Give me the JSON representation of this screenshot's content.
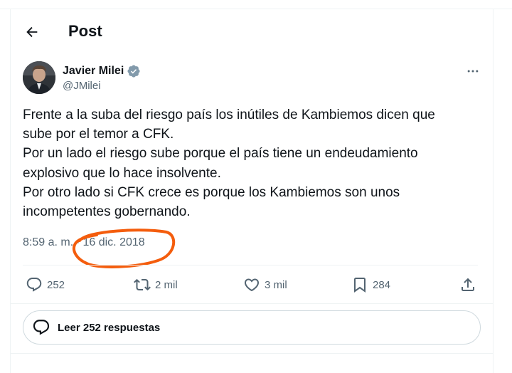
{
  "header": {
    "title": "Post",
    "back_icon": "arrow-left-icon"
  },
  "author": {
    "name": "Javier Milei",
    "handle": "@JMilei",
    "verified_icon": "verified-badge-icon",
    "verified_color": "#829aab"
  },
  "tweet": {
    "lines": [
      "Frente a la suba del riesgo país los inútiles de Kambiemos dicen que",
      "sube por el temor a CFK.",
      "Por un lado el riesgo sube porque el país tiene un endeudamiento",
      "explosivo que lo hace insolvente.",
      "Por otro lado si CFK crece es porque los Kambiemos son unos",
      "incompetentes gobernando."
    ]
  },
  "meta": {
    "time": "8:59 a. m.",
    "separator": "·",
    "date": "16 dic. 2018",
    "annotation_color": "#f45d0d"
  },
  "actions": {
    "replies": "252",
    "retweets": "2 mil",
    "likes": "3 mil",
    "bookmarks": "284"
  },
  "read_replies_label": "Leer 252 respuestas",
  "colors": {
    "text": "#0f1419",
    "secondary": "#536471",
    "border": "#cfd9de"
  }
}
